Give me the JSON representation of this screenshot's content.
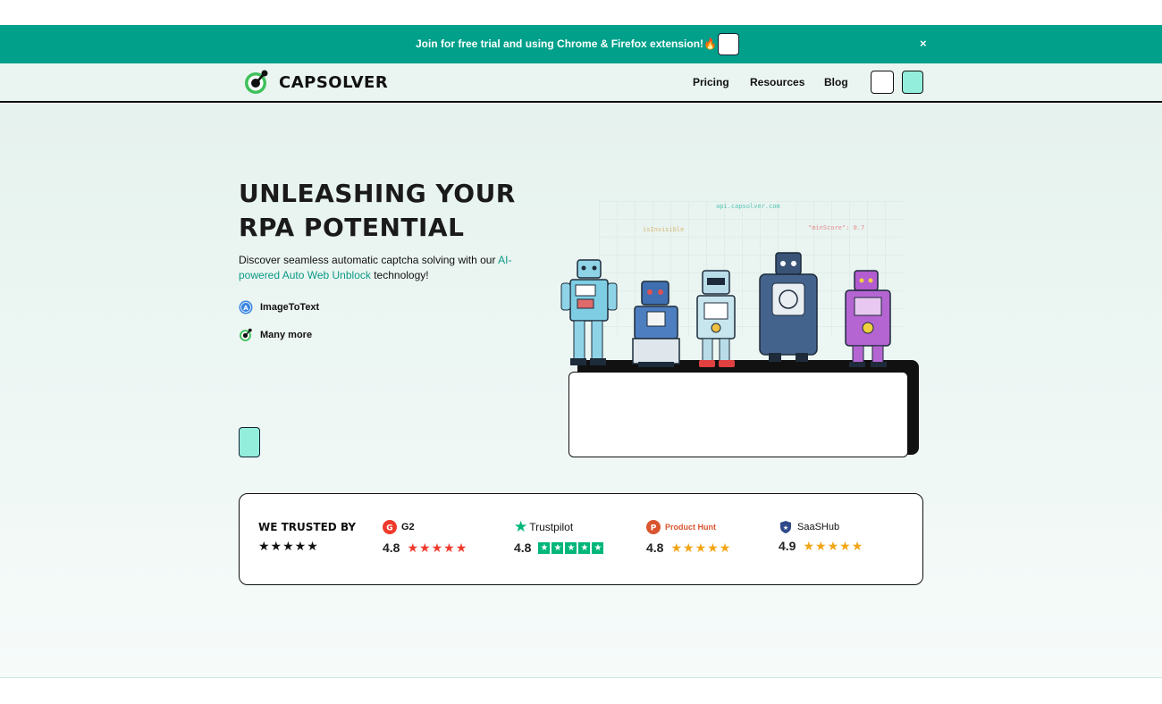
{
  "announcement": {
    "text": "Join for free trial and using Chrome & Firefox extension!🔥",
    "close_label": "×"
  },
  "header": {
    "logo_text": "CAPSOLVER",
    "nav": [
      "Pricing",
      "Resources",
      "Blog"
    ]
  },
  "hero": {
    "title": "UNLEASHING YOUR RPA POTENTIAL",
    "desc_before": "Discover seamless automatic captcha solving with our ",
    "desc_accent": "AI-powered Auto Web Unblock",
    "desc_after": " technology!",
    "features": [
      {
        "label": "ImageToText",
        "icon": "image-to-text-icon"
      },
      {
        "label": "Many more",
        "icon": "capsolver-logo-icon"
      }
    ]
  },
  "illustration": {
    "tags": {
      "api": "api.capsolver.com",
      "invisible": "isInvisible",
      "min_score": "\"minScore\": 0.7"
    },
    "robots": [
      "robot-1",
      "robot-2",
      "robot-3",
      "robot-4",
      "robot-5"
    ]
  },
  "trusted": {
    "title": "WE TRUSTED BY",
    "stars": "★★★★★",
    "reviews": [
      {
        "name": "G2",
        "score": "4.8",
        "color": "#ef3a2d"
      },
      {
        "name": "Trustpilot",
        "score": "4.8",
        "color": "#00b67a"
      },
      {
        "name": "Product Hunt",
        "score": "4.8",
        "color": "#da552f"
      },
      {
        "name": "SaaSHub",
        "score": "4.9",
        "color": "#2e4a8a"
      }
    ]
  },
  "colors": {
    "brand": "#00a08a",
    "accent_mint": "#93efdc",
    "star_red": "#ef3a2d",
    "star_gold": "#f2a516"
  }
}
